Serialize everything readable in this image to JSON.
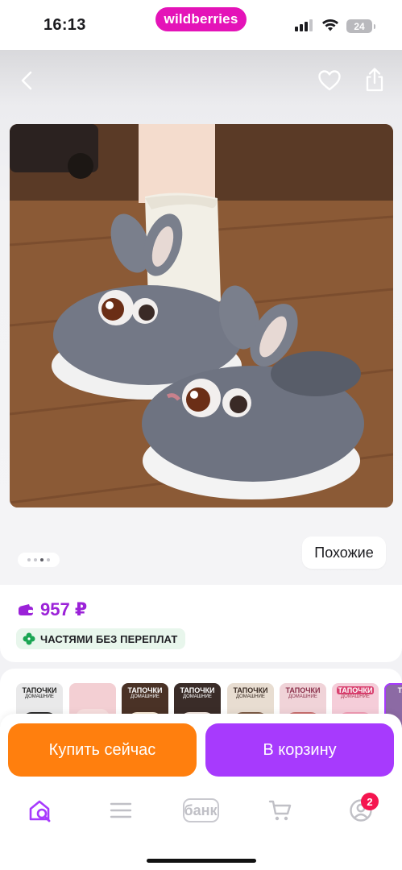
{
  "status_bar": {
    "time": "16:13",
    "brand": "wildberries",
    "battery": "24",
    "signal_icon": "signal-icon",
    "wifi_icon": "wifi-icon"
  },
  "header": {
    "back_icon": "chevron-left-icon",
    "favorite_icon": "heart-icon",
    "share_icon": "share-icon"
  },
  "gallery": {
    "image_description_icon": "product-photo",
    "page_count": 4,
    "active_page": 3,
    "similar_label": "Похожие"
  },
  "price": {
    "wallet_icon": "wallet-icon",
    "value": "957 ₽",
    "installment_label": "ЧАСТЯМИ БЕЗ ПЕРЕПЛАТ",
    "installment_icon": "clover-icon",
    "accent_color": "#9b22d8"
  },
  "thumbnails": [
    {
      "label": "ТАПОЧКИ",
      "sub": "ДОМАШНИЕ"
    },
    {
      "label": "",
      "sub": ""
    },
    {
      "label": "ТАПОЧКИ",
      "sub": "ДОМАШНИЕ"
    },
    {
      "label": "ТАПОЧКИ",
      "sub": "ДОМАШНИЕ"
    },
    {
      "label": "ТАПОЧКИ",
      "sub": "ДОМАШНИЕ"
    },
    {
      "label": "ТАПОЧКИ",
      "sub": "ДОМАШНИЕ"
    },
    {
      "label": "ТАПОЧКИ",
      "sub": "ДОМАШНИЕ"
    },
    {
      "label": "ТАПО",
      "sub": ""
    }
  ],
  "actions": {
    "buy_now_label": "Купить сейчас",
    "buy_now_color": "#ff7f0e",
    "add_to_cart_label": "В корзину",
    "add_to_cart_color": "#a73afd"
  },
  "bottom_nav": {
    "home_icon": "home-search-icon",
    "catalog_icon": "menu-icon",
    "bank_label": "банк",
    "cart_icon": "cart-icon",
    "profile_icon": "profile-icon",
    "profile_badge": "2"
  }
}
